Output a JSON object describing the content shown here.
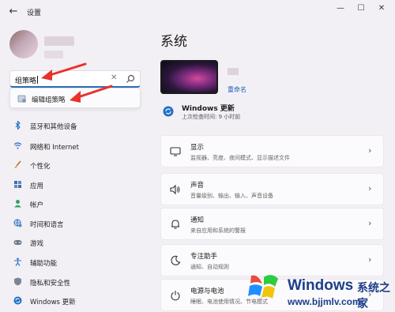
{
  "window": {
    "title": "设置",
    "back_glyph": "←",
    "min_glyph": "—",
    "max_glyph": "☐",
    "close_glyph": "✕"
  },
  "search": {
    "value": "组策略",
    "clear_glyph": "✕",
    "suggestion": "编辑组策略"
  },
  "sidebar": {
    "items": [
      {
        "label": "蓝牙和其他设备",
        "icon": "bluetooth-icon"
      },
      {
        "label": "网络和 Internet",
        "icon": "wifi-icon"
      },
      {
        "label": "个性化",
        "icon": "brush-icon"
      },
      {
        "label": "应用",
        "icon": "apps-icon"
      },
      {
        "label": "帐户",
        "icon": "account-icon"
      },
      {
        "label": "时间和语言",
        "icon": "globe-clock-icon"
      },
      {
        "label": "游戏",
        "icon": "gamepad-icon"
      },
      {
        "label": "辅助功能",
        "icon": "accessibility-icon"
      },
      {
        "label": "隐私和安全性",
        "icon": "shield-icon"
      },
      {
        "label": "Windows 更新",
        "icon": "update-icon"
      }
    ]
  },
  "main": {
    "title": "系统",
    "rename": "重命名",
    "update": {
      "title": "Windows 更新",
      "subtitle": "上次检查时间: 9 小时前"
    },
    "cards": [
      {
        "title": "显示",
        "subtitle": "监视器、亮度、夜间模式、显示描述文件",
        "icon": "display-icon"
      },
      {
        "title": "声音",
        "subtitle": "音量级别、输出、输入、声音设备",
        "icon": "speaker-icon"
      },
      {
        "title": "通知",
        "subtitle": "来自应用和系统的警报",
        "icon": "bell-icon"
      },
      {
        "title": "专注助手",
        "subtitle": "通知、自动规则",
        "icon": "moon-icon"
      },
      {
        "title": "电源与电池",
        "subtitle": "睡眠、电池使用情况、节电模式",
        "icon": "power-icon"
      }
    ],
    "chevron": "›"
  },
  "watermark": {
    "title": "Windows",
    "cn": "系统之家",
    "url": "www.bjjmlv.com"
  },
  "colors": {
    "accent": "#2b6fb8",
    "arrow": "#e8322c"
  }
}
